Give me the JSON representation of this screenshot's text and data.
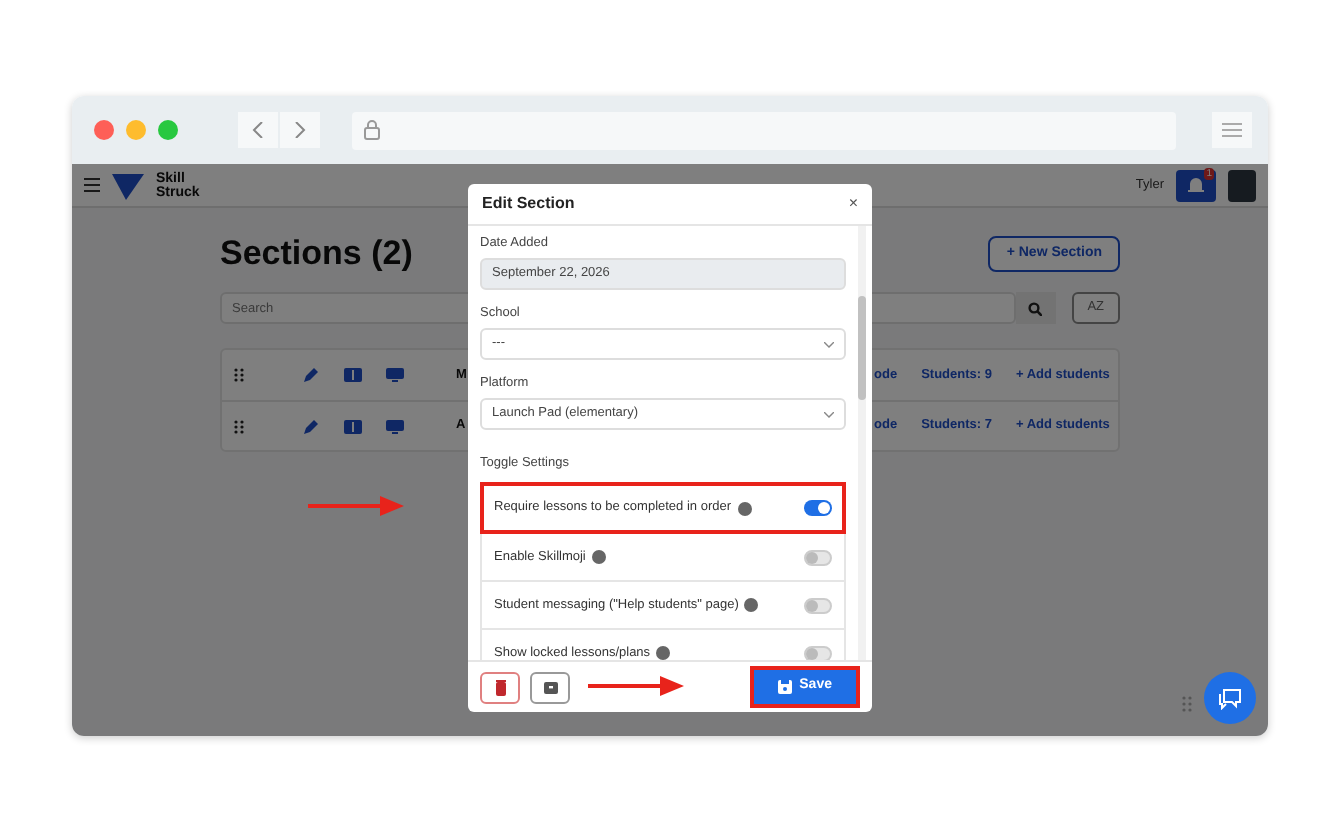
{
  "app_header": {
    "logo_lines": [
      "Skill",
      "Struck"
    ],
    "user_name": "Tyler",
    "notification_count": "1"
  },
  "page": {
    "title": "Sections (2)",
    "new_button": "+ New Section",
    "search_placeholder": "Search",
    "sort_button": "AZ"
  },
  "sections": [
    {
      "name": "M",
      "code_link": "ode",
      "students": "Students: 9",
      "add_students": "+ Add students"
    },
    {
      "name": "A",
      "code_link": "ode",
      "students": "Students: 7",
      "add_students": "+ Add students"
    }
  ],
  "modal": {
    "title": "Edit Section",
    "close": "×",
    "fields": [
      {
        "label": "Date Added",
        "kind": "readonly",
        "value": "September 22, 2026"
      },
      {
        "label": "School",
        "kind": "select",
        "value": "---"
      },
      {
        "label": "Platform",
        "kind": "select",
        "value": "Launch Pad (elementary)"
      }
    ],
    "toggle_heading": "Toggle Settings",
    "toggles": [
      {
        "label": "Require lessons to be completed in order",
        "on": true,
        "highlighted": true
      },
      {
        "label": "Enable Skillmoji",
        "on": false,
        "highlighted": false
      },
      {
        "label": "Student messaging (\"Help students\" page)",
        "on": false,
        "highlighted": false
      },
      {
        "label": "Show locked lessons/plans",
        "on": false,
        "highlighted": false
      }
    ],
    "save_button": {
      "label": "Save",
      "highlighted": true
    }
  }
}
